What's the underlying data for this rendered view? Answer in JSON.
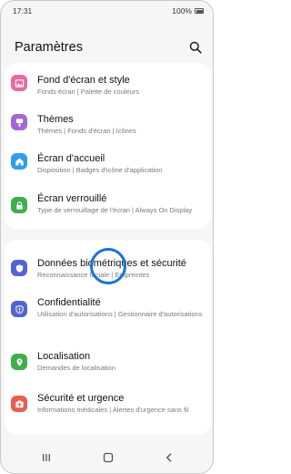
{
  "status_bar": {
    "time": "17:31",
    "battery": "100%"
  },
  "header": {
    "title": "Paramètres"
  },
  "icons": {
    "search": "search-icon",
    "wallpaper": "image-icon",
    "themes": "brush-icon",
    "home": "home-icon",
    "lock": "lock-icon",
    "biometrics": "shield-icon",
    "privacy": "privacy-shield-icon",
    "location": "location-pin-icon",
    "emergency": "emergency-icon"
  },
  "colors": {
    "wallpaper": "#ea6aa0",
    "themes": "#a567d8",
    "home": "#2f9ef0",
    "lock": "#3fae4c",
    "biometrics": "#5561d6",
    "privacy": "#5561d6",
    "location": "#3fae4c",
    "emergency": "#e85f50",
    "tap_ring": "#1a72d8"
  },
  "card1": [
    {
      "title": "Fond d'écran et style",
      "subtitle": "Fonds écran  |  Palette de couleurs"
    },
    {
      "title": "Thèmes",
      "subtitle": "Thèmes  |  Fonds d'écran  |  Icônes"
    },
    {
      "title": "Écran d'accueil",
      "subtitle": "Disposition  |  Badges d'icône d'application"
    },
    {
      "title": "Écran verrouillé",
      "subtitle": "Type de verrouillage de l'écran  |  Always On Display"
    }
  ],
  "card2": [
    {
      "title": "Données biométriques et sécurité",
      "subtitle": "Reconnaissance faciale  |  Empreintes"
    },
    {
      "title": "Confidentialité",
      "subtitle": "Utilisation d'autorisations  |  Gestionnaire d'autorisations"
    },
    {
      "title": "Localisation",
      "subtitle": "Demandes de localisation"
    },
    {
      "title": "Sécurité et urgence",
      "subtitle": "Informations médicales  |  Alertes d'urgence sans fil"
    }
  ],
  "nav": {
    "recents": "recents-icon",
    "home": "home-button-icon",
    "back": "back-icon"
  }
}
